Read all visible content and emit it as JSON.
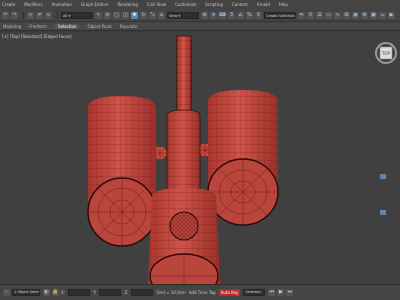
{
  "menu": {
    "items": [
      "Create",
      "Modifiers",
      "Animation",
      "Graph Editors",
      "Rendering",
      "Civil View",
      "Customize",
      "Scripting",
      "Content",
      "Arnold",
      "Help"
    ]
  },
  "toolbar": {
    "selection_set_value": "Create Selection Se"
  },
  "ribbon": {
    "tabs": [
      "Modeling",
      "Freeform",
      "Selection",
      "Object Paint",
      "Populate"
    ],
    "selected": "Selection"
  },
  "viewport": {
    "label": "[+] [Top] [Standard] [Edged Faces]",
    "mesh_color": "#c94b43",
    "edge_color": "#5a1410"
  },
  "status": {
    "selected": "1 Object Selected",
    "x_label": "X:",
    "x_value": "",
    "y_label": "Y:",
    "y_value": "",
    "z_label": "Z:",
    "z_value": "",
    "grid": "Grid = 10,0cm",
    "add_time_tag": "Add Time Tag",
    "autokey": "Auto Key",
    "selected_filter": "Selected"
  }
}
